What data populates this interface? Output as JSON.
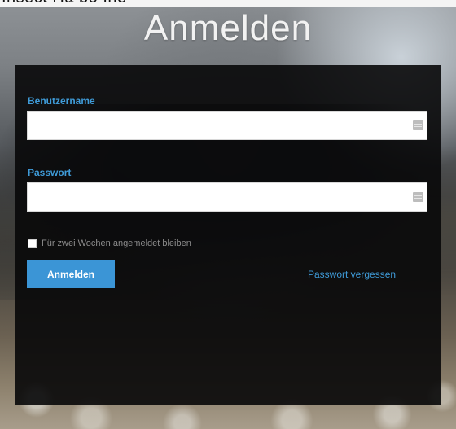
{
  "top_strip": {
    "text": "Insect Ha bo Ine"
  },
  "page": {
    "title": "Anmelden"
  },
  "form": {
    "username": {
      "label": "Benutzername",
      "value": "",
      "placeholder": ""
    },
    "password": {
      "label": "Passwort",
      "value": "",
      "placeholder": ""
    },
    "remember": {
      "label": "Für zwei Wochen angemeldet bleiben",
      "checked": false
    },
    "submit_label": "Anmelden",
    "forgot_label": "Passwort vergessen"
  },
  "icons": {
    "field_icon": "password-manager-icon"
  },
  "colors": {
    "accent": "#3b95d6",
    "label": "#3f9bd8",
    "panel": "#080809"
  }
}
